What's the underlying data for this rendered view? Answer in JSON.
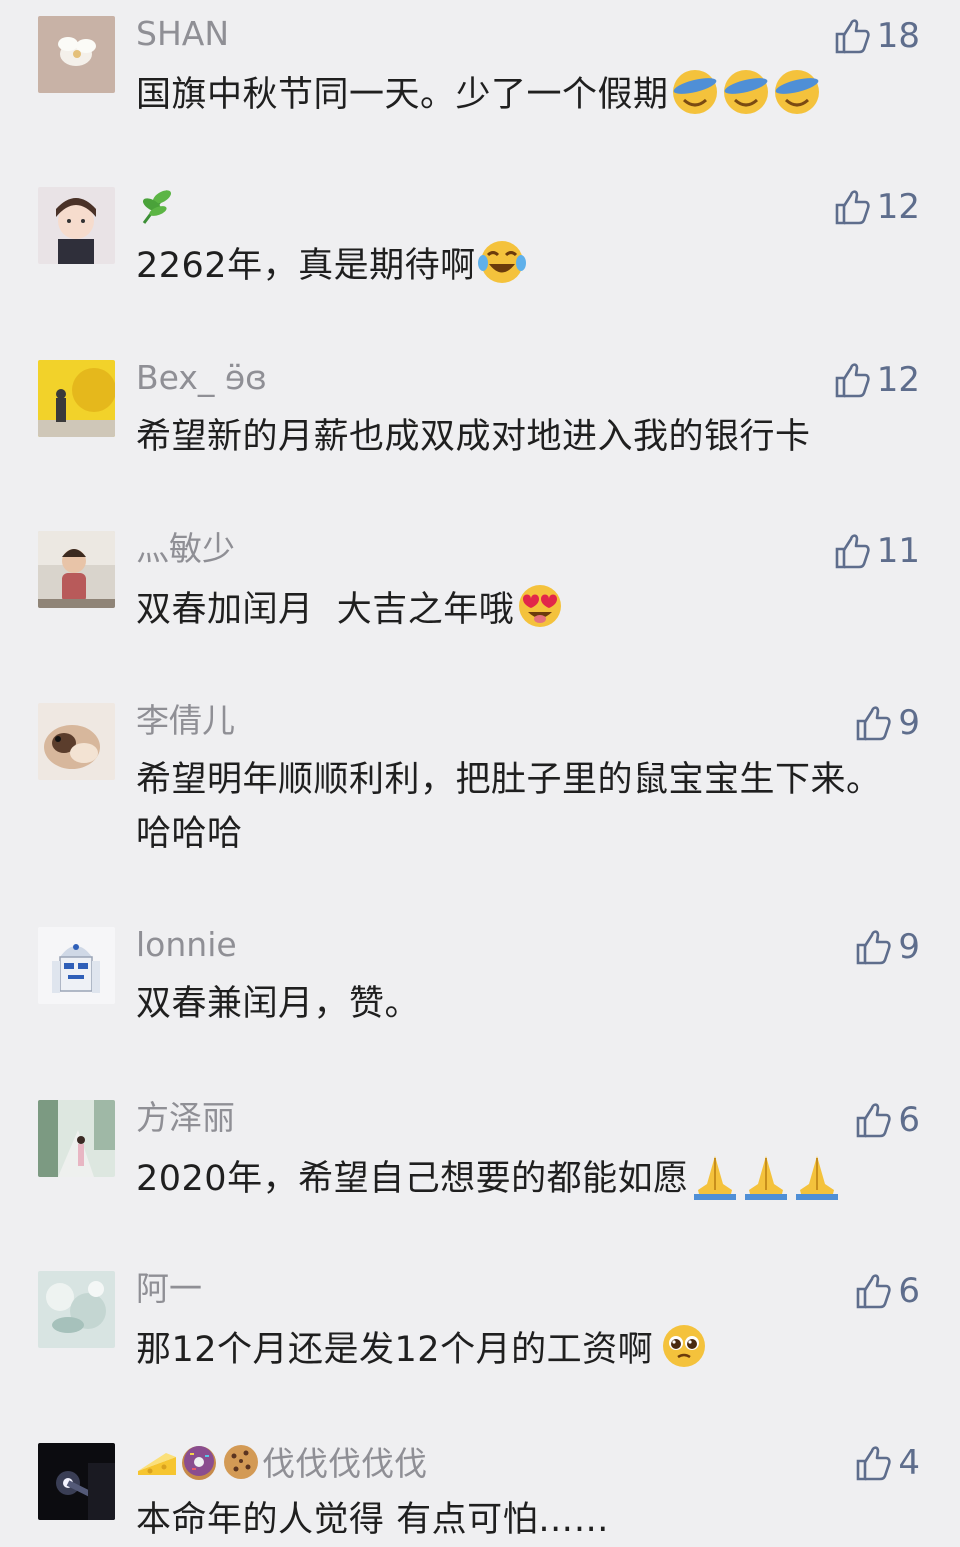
{
  "comments": [
    {
      "name": "SHAN",
      "text": "国旗中秋节同一天。少了一个假期",
      "likes": "18"
    },
    {
      "name": "",
      "text": "2262年，真是期待啊",
      "likes": "12"
    },
    {
      "name": "Bex_ ɘ̈ɞ",
      "text": "希望新的月薪也成双成对地进入我的银行卡",
      "likes": "12"
    },
    {
      "name": "灬敏少",
      "text": "双春加闰月  大吉之年哦",
      "likes": "11"
    },
    {
      "name": "李倩儿",
      "text": "希望明年顺顺利利，把肚子里的鼠宝宝生下来。哈哈哈",
      "likes": "9"
    },
    {
      "name": "lonnie",
      "text": "双春兼闰月，赞。",
      "likes": "9"
    },
    {
      "name": "方泽丽",
      "text": "2020年，希望自己想要的都能如愿",
      "likes": "6"
    },
    {
      "name": "阿一",
      "text": "那12个月还是发12个月的工资啊",
      "likes": "6"
    },
    {
      "name": "伐伐伐伐伐",
      "text": "本命年的人觉得 有点可怕……",
      "likes": "4"
    }
  ],
  "colors": {
    "background": "#efeff1",
    "name": "#8f8f95",
    "text": "#1f1f1f",
    "like": "#5e6d8c"
  },
  "icons": {
    "like": "thumbs-up-icon"
  }
}
